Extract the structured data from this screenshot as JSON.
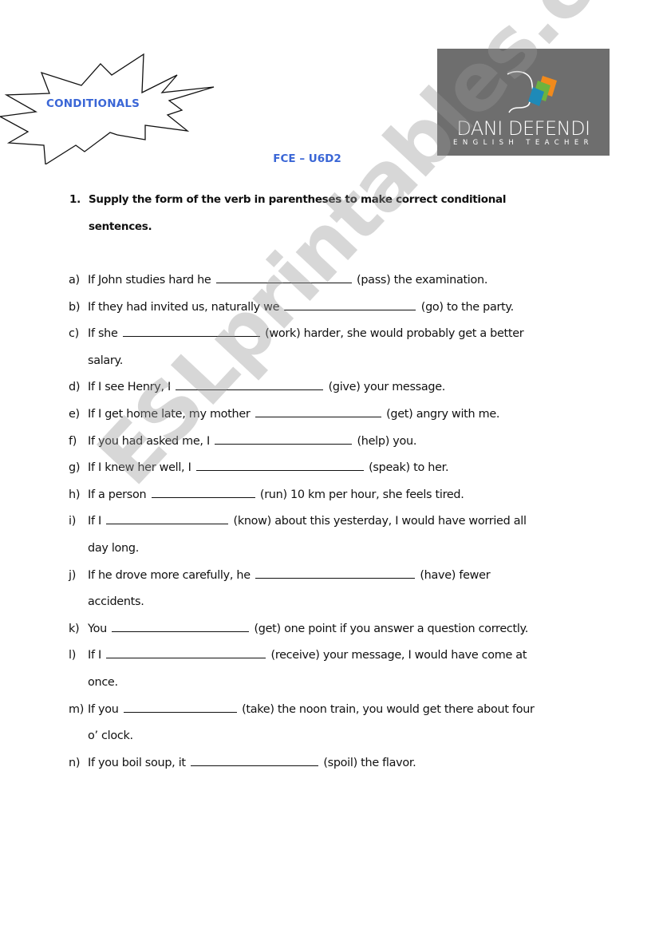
{
  "header": {
    "burst_title": "CONDITIONALS",
    "logo": {
      "name": "DANI DEFENDI",
      "tagline": "ENGLISH TEACHER"
    },
    "subtitle": "FCE – U6D2",
    "colors": {
      "title_blue": "#3a66d6",
      "logo_bg": "#6e6e6e"
    }
  },
  "exercise": {
    "number": "1.",
    "instruction_line1": "Supply the form of the verb in parentheses to make correct conditional",
    "instruction_line2": "sentences."
  },
  "items": [
    {
      "letter": "a)",
      "before": "If John studies hard he",
      "after": "(pass) the examination.",
      "cont": ""
    },
    {
      "letter": "b)",
      "before": "If they had invited us, naturally we",
      "after": "(go) to the party.",
      "cont": ""
    },
    {
      "letter": "c)",
      "before": "If she",
      "after": "(work) harder, she would probably get a better",
      "cont": "salary."
    },
    {
      "letter": "d)",
      "before": "If I see Henry, I",
      "after": "(give) your message.",
      "cont": ""
    },
    {
      "letter": "e)",
      "before": "If I get home late, my mother",
      "after": "(get) angry with me.",
      "cont": ""
    },
    {
      "letter": "f)",
      "before": "If you had asked me, I",
      "after": "(help) you.",
      "cont": ""
    },
    {
      "letter": "g)",
      "before": "If I knew her well, I",
      "after": "(speak) to her.",
      "cont": ""
    },
    {
      "letter": "h)",
      "before": "If a person",
      "after": "(run) 10 km per hour, she feels tired.",
      "cont": ""
    },
    {
      "letter": "i)",
      "before": "If I",
      "after": "(know) about this yesterday, I would have worried all",
      "cont": "day long."
    },
    {
      "letter": "j)",
      "before": "If he drove more carefully, he",
      "after": "(have) fewer",
      "cont": "accidents."
    },
    {
      "letter": "k)",
      "before": "You",
      "after": "(get) one point if you answer a question correctly.",
      "cont": ""
    },
    {
      "letter": "l)",
      "before": "If I",
      "after": "(receive) your message, I would have come at",
      "cont": "once."
    },
    {
      "letter": "m)",
      "before": "If you",
      "after": "(take) the noon train, you would get there about four",
      "cont": "o’ clock."
    },
    {
      "letter": "n)",
      "before": "If you boil soup, it",
      "after": "(spoil) the flavor.",
      "cont": ""
    }
  ],
  "watermark": "ESLprintables.com"
}
